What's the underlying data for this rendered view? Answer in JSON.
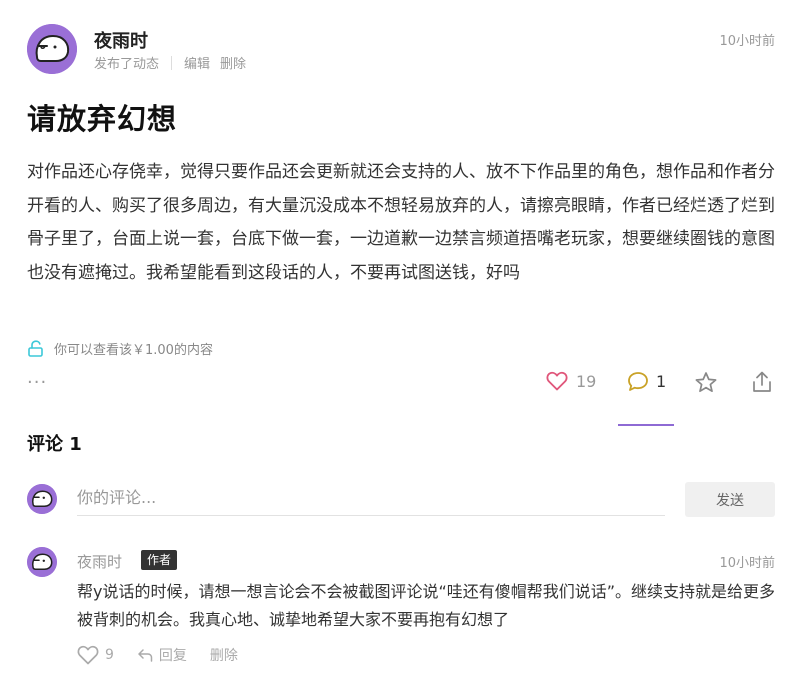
{
  "post": {
    "author": "夜雨时",
    "action": "发布了动态",
    "edit_label": "编辑",
    "delete_label": "删除",
    "time": "10小时前",
    "title": "请放弃幻想",
    "body": "对作品还心存侥幸，觉得只要作品还会更新就还会支持的人、放不下作品里的角色，想作品和作者分开看的人、购买了很多周边，有大量沉没成本不想轻易放弃的人，请擦亮眼睛，作者已经烂透了烂到骨子里了，台面上说一套，台底下做一套，一边道歉一边禁言频道捂嘴老玩家，想要继续圈钱的意图也没有遮掩过。我希望能看到这段话的人，不要再试图送钱，好吗",
    "paywall_text": "你可以查看该￥1.00的内容",
    "more_label": "···",
    "likes": "19",
    "comments": "1"
  },
  "comments_section": {
    "heading": "评论 1",
    "input_placeholder": "你的评论...",
    "send_label": "发送"
  },
  "comment": {
    "author": "夜雨时",
    "badge": "作者",
    "time": "10小时前",
    "text": "帮y说话的时候，请想一想言论会不会被截图评论说“哇还有傻帽帮我们说话”。继续支持就是给更多被背刺的机会。我真心地、诚挚地希望大家不要再抱有幻想了",
    "likes": "9",
    "reply_label": "回复",
    "delete_label": "删除"
  },
  "colors": {
    "accent": "#8e6ad4",
    "avatar_bg": "#9a6fd6",
    "like_pink": "#e0567a",
    "comment_gold": "#c9a227",
    "lock_cyan": "#3cc8d8"
  },
  "icons": [
    "avatar-ghost",
    "lock-open-icon",
    "heart-icon",
    "comment-icon",
    "star-icon",
    "share-icon",
    "reply-icon"
  ]
}
